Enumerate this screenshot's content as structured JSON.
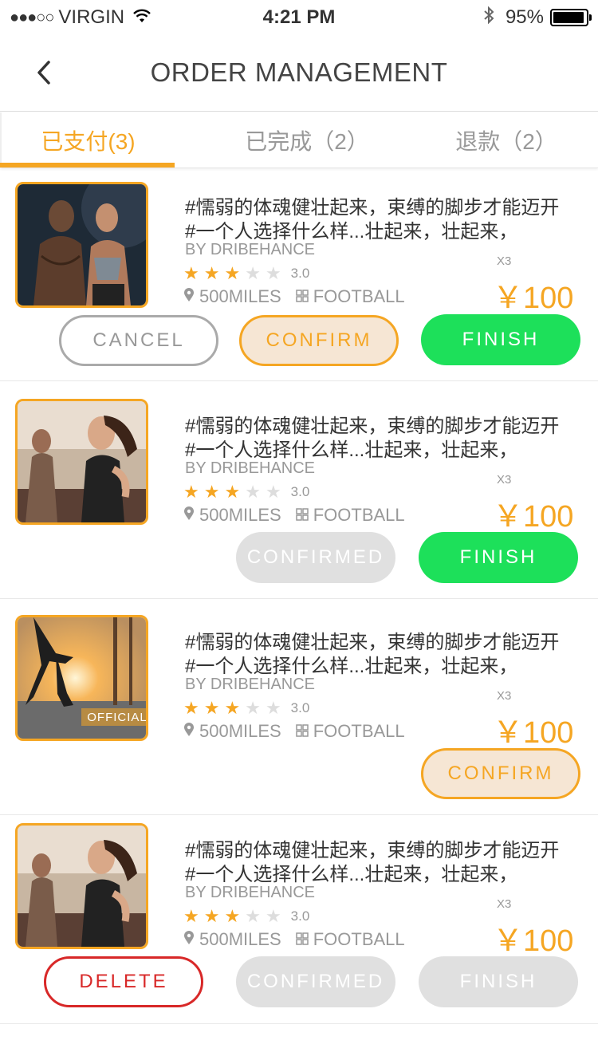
{
  "status": {
    "carrier": "VIRGIN",
    "time": "4:21 PM",
    "battery": "95%",
    "battery_level": 0.95
  },
  "nav": {
    "title": "ORDER MANAGEMENT"
  },
  "tabs": [
    {
      "label": "已支付(3)",
      "active": true
    },
    {
      "label": "已完成（2）",
      "active": false
    },
    {
      "label": "退款（2）",
      "active": false
    }
  ],
  "orders": [
    {
      "title_line1": "#懦弱的体魂健壮起来，束缚的脚步才能迈开",
      "title_line2": "#一个人选择什么样...壮起来，壮起来，",
      "by": "BY DRIBEHANCE",
      "rating": "3.0",
      "stars": 3,
      "distance": "500MILES",
      "category": "FOOTBALL",
      "qty": "X3",
      "price": "￥100",
      "buttons": [
        "CANCEL",
        "CONFIRM",
        "FINISH"
      ]
    },
    {
      "title_line1": "#懦弱的体魂健壮起来，束缚的脚步才能迈开",
      "title_line2": "#一个人选择什么样...壮起来，壮起来，",
      "by": "BY DRIBEHANCE",
      "rating": "3.0",
      "stars": 3,
      "distance": "500MILES",
      "category": "FOOTBALL",
      "qty": "X3",
      "price": "￥100",
      "buttons": [
        "CONFIRMED",
        "FINISH"
      ]
    },
    {
      "title_line1": "#懦弱的体魂健壮起来，束缚的脚步才能迈开",
      "title_line2": "#一个人选择什么样...壮起来，壮起来，",
      "by": "BY DRIBEHANCE",
      "rating": "3.0",
      "stars": 3,
      "distance": "500MILES",
      "category": "FOOTBALL",
      "qty": "X3",
      "price": "￥100",
      "badge": "OFFICIAL",
      "buttons": [
        "CONFIRM"
      ]
    },
    {
      "title_line1": "#懦弱的体魂健壮起来，束缚的脚步才能迈开",
      "title_line2": "#一个人选择什么样...壮起来，壮起来，",
      "by": "BY DRIBEHANCE",
      "rating": "3.0",
      "stars": 3,
      "distance": "500MILES",
      "category": "FOOTBALL",
      "qty": "X3",
      "price": "￥100",
      "buttons": [
        "DELETE",
        "CONFIRMED",
        "FINISH"
      ]
    }
  ],
  "colors": {
    "accent": "#f5a623",
    "finish": "#1de05a",
    "delete": "#d82828",
    "disabled": "#e0e0e0"
  },
  "icons": {
    "back": "chevron-left-icon",
    "star": "star-icon",
    "location": "location-pin-icon",
    "category": "grid-icon",
    "wifi": "wifi-icon",
    "bluetooth": "bluetooth-icon"
  }
}
